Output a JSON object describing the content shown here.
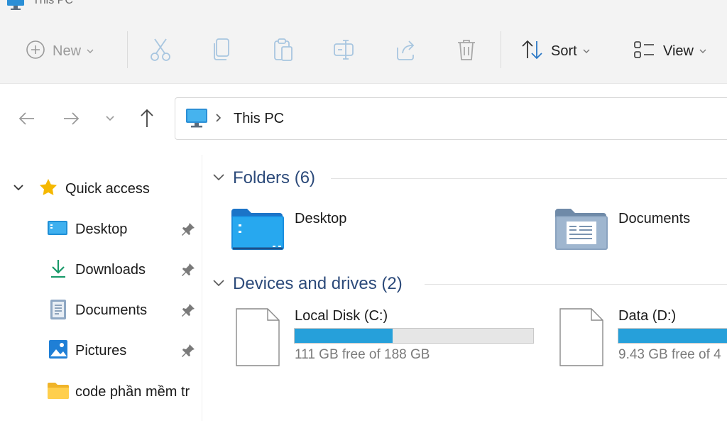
{
  "window": {
    "title": "This PC"
  },
  "toolbar": {
    "new_label": "New",
    "sort_label": "Sort",
    "view_label": "View",
    "icons": [
      "cut-icon",
      "copy-icon",
      "paste-icon",
      "rename-icon",
      "share-icon",
      "delete-icon"
    ]
  },
  "address": {
    "crumb": "This PC"
  },
  "nav": {
    "quick_access": "Quick access",
    "items": [
      {
        "label": "Desktop",
        "pinned": true,
        "icon": "desktop-icon"
      },
      {
        "label": "Downloads",
        "pinned": true,
        "icon": "download-icon"
      },
      {
        "label": "Documents",
        "pinned": true,
        "icon": "documents-icon"
      },
      {
        "label": "Pictures",
        "pinned": true,
        "icon": "pictures-icon"
      },
      {
        "label": "code phần mềm tr",
        "pinned": false,
        "icon": "folder-icon"
      }
    ]
  },
  "folders": {
    "header": "Folders (6)",
    "items": [
      {
        "name": "Desktop",
        "icon": "desktop-folder-icon"
      },
      {
        "name": "Documents",
        "icon": "documents-folder-icon"
      }
    ]
  },
  "drives": {
    "header": "Devices and drives (2)",
    "items": [
      {
        "name": "Local Disk (C:)",
        "free_text": "111 GB free of 188 GB",
        "used_fraction": 0.41
      },
      {
        "name": "Data (D:)",
        "free_text": "9.43 GB free of 4",
        "used_fraction": 0.95
      }
    ]
  },
  "colors": {
    "accent": "#26a0da",
    "section_header": "#2c4a7a",
    "star": "#f5b800"
  }
}
